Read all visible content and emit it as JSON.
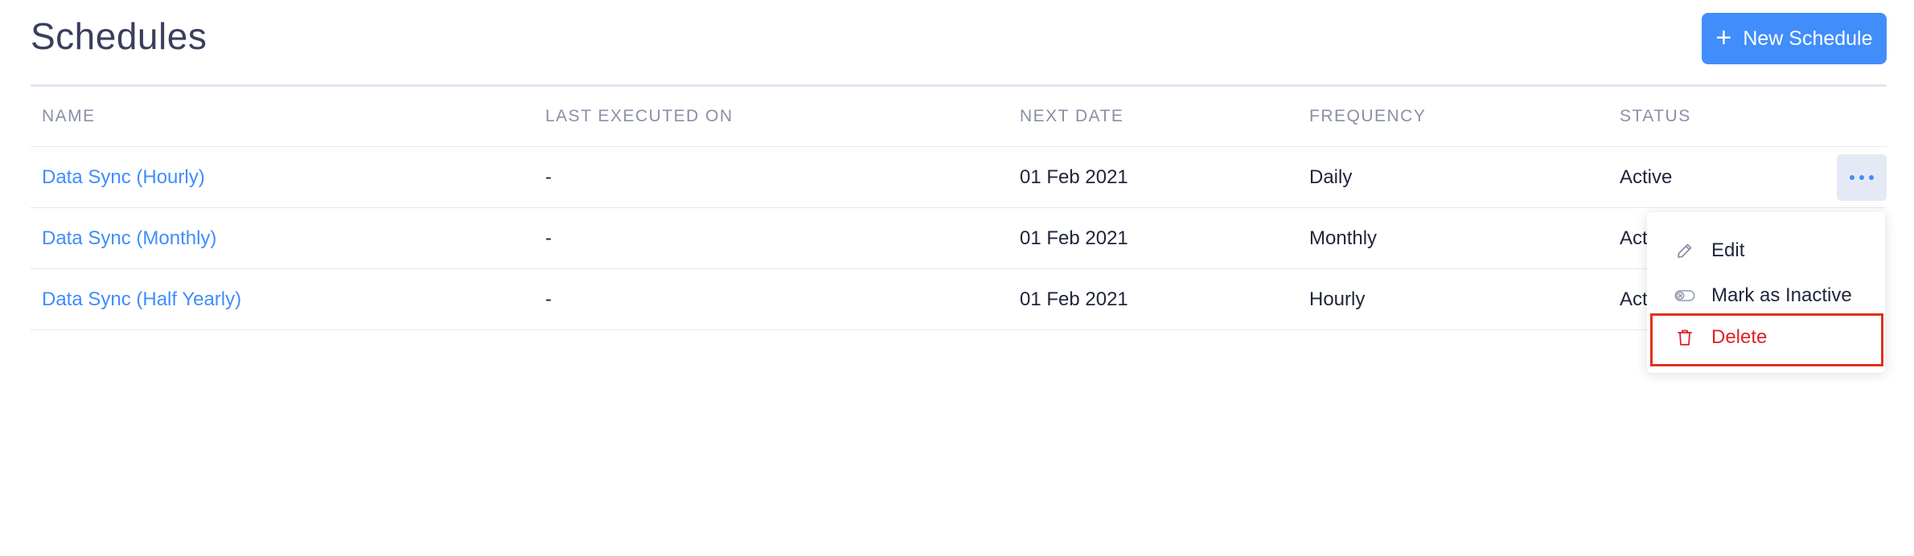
{
  "page": {
    "title": "Schedules",
    "new_button_label": "New Schedule",
    "new_button_icon": "plus-icon"
  },
  "table": {
    "columns": [
      "NAME",
      "LAST EXECUTED ON",
      "NEXT DATE",
      "FREQUENCY",
      "STATUS"
    ],
    "rows": [
      {
        "name": "Data Sync (Hourly)",
        "last_executed": "-",
        "next_date": "01 Feb 2021",
        "frequency": "Daily",
        "status": "Active"
      },
      {
        "name": "Data Sync (Monthly)",
        "last_executed": "-",
        "next_date": "01 Feb 2021",
        "frequency": "Monthly",
        "status": "Act"
      },
      {
        "name": "Data Sync (Half Yearly)",
        "last_executed": "-",
        "next_date": "01 Feb 2021",
        "frequency": "Hourly",
        "status": "Act"
      }
    ]
  },
  "row_menu": {
    "icon": "more-horizontal-icon",
    "items": [
      {
        "label": "Edit",
        "icon": "pencil-icon"
      },
      {
        "label": "Mark as Inactive",
        "icon": "toggle-off-icon"
      },
      {
        "label": "Delete",
        "icon": "trash-icon"
      }
    ]
  },
  "colors": {
    "accent": "#408dfb",
    "danger": "#e02020",
    "highlight_border": "#e0301e",
    "header_text": "#8a8fa8"
  }
}
